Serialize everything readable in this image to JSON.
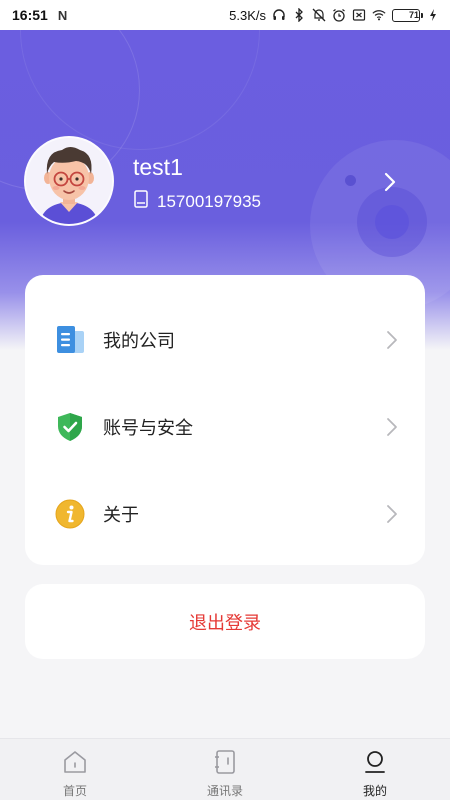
{
  "status_bar": {
    "time": "16:51",
    "notification_icon": "N",
    "net_speed": "5.3K/s",
    "battery_level": "71",
    "battery_fraction": 0.71,
    "icons": [
      "headphones-icon",
      "bluetooth-icon",
      "mute-icon",
      "alarm-icon",
      "sim-off-icon",
      "wifi-icon",
      "battery-icon",
      "charging-icon"
    ]
  },
  "profile": {
    "username": "test1",
    "phone": "15700197935",
    "avatar_icon": "avatar-cartoon-man-glasses",
    "chevron_icon": "chevron-right-icon"
  },
  "menu": {
    "items": [
      {
        "label": "我的公司",
        "icon": "company-document-icon",
        "color": "#4a9de8"
      },
      {
        "label": "账号与安全",
        "icon": "shield-check-icon",
        "color": "#3fb85a"
      },
      {
        "label": "关于",
        "icon": "info-icon",
        "color": "#f0b72f"
      }
    ]
  },
  "logout": {
    "label": "退出登录",
    "color": "#e53935"
  },
  "tab_bar": {
    "tabs": [
      {
        "label": "首页",
        "icon": "home-icon",
        "active": false
      },
      {
        "label": "通讯录",
        "icon": "contacts-book-icon",
        "active": false
      },
      {
        "label": "我的",
        "icon": "profile-icon",
        "active": true
      }
    ]
  },
  "colors": {
    "header_purple": "#6b5ee0",
    "background": "#f5f5f7",
    "card": "#ffffff"
  }
}
